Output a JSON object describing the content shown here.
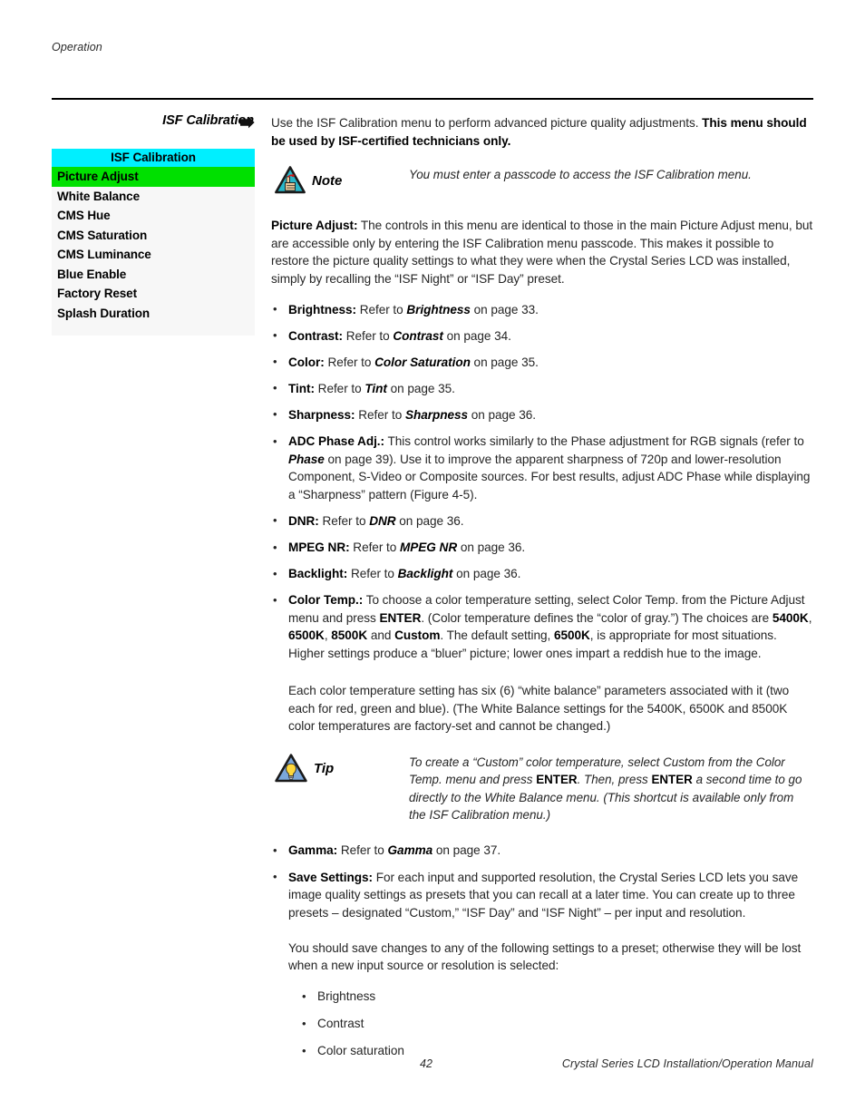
{
  "header": {
    "running_head": "Operation",
    "section_title": "ISF Calibration",
    "arrow_icon": "right-arrow-marker"
  },
  "osd_menu": {
    "title": "ISF Calibration",
    "title_color": "#00EFFF",
    "selected_color": "#00E000",
    "items": [
      {
        "label": "Picture Adjust",
        "selected": true
      },
      {
        "label": "White Balance",
        "selected": false
      },
      {
        "label": "CMS Hue",
        "selected": false
      },
      {
        "label": "CMS Saturation",
        "selected": false
      },
      {
        "label": "CMS Luminance",
        "selected": false
      },
      {
        "label": "Blue Enable",
        "selected": false
      },
      {
        "label": "Factory Reset",
        "selected": false
      },
      {
        "label": "Splash Duration",
        "selected": false
      }
    ]
  },
  "intro": {
    "text_normal": "Use the ISF Calibration menu to perform advanced picture quality adjustments. ",
    "text_bold": "This menu should be used by ISF-certified technicians only."
  },
  "note": {
    "icon": "note-triangle-hand-icon",
    "label": "Note",
    "text": "You must enter a passcode to access the ISF Calibration menu."
  },
  "picture_adjust": {
    "lead_bold": "Picture Adjust:",
    "lead_text": " The controls in this menu are identical to those in the main Picture Adjust menu, but are accessible only by entering the ISF Calibration menu passcode. This makes it possible to restore the picture quality settings to what they were when the Crystal Series LCD was installed, simply by recalling the “ISF Night” or “ISF Day” preset."
  },
  "bullets": [
    {
      "term": "Brightness:",
      "pre": " Refer to ",
      "ref": "Brightness",
      "post": " on page 33."
    },
    {
      "term": "Contrast:",
      "pre": " Refer to ",
      "ref": "Contrast",
      "post": " on page 34."
    },
    {
      "term": "Color:",
      "pre": " Refer to ",
      "ref": "Color Saturation",
      "post": " on page 35."
    },
    {
      "term": "Tint:",
      "pre": " Refer to ",
      "ref": "Tint",
      "post": " on page 35."
    },
    {
      "term": "Sharpness:",
      "pre": " Refer to ",
      "ref": "Sharpness",
      "post": " on page 36."
    }
  ],
  "adc_bullet": {
    "term": "ADC Phase Adj.:",
    "part1": " This control works similarly to the Phase adjustment for RGB signals (refer to ",
    "ref": "Phase",
    "part2": " on page 39). Use it to improve the apparent sharpness of 720p and lower-resolution Component, S-Video or Composite sources. For best results, adjust ADC Phase while displaying a “Sharpness” pattern (Figure 4-5)."
  },
  "bullets2": [
    {
      "term": "DNR:",
      "pre": " Refer to ",
      "ref": "DNR",
      "post": " on page 36."
    },
    {
      "term": "MPEG NR:",
      "pre": " Refer to ",
      "ref": "MPEG NR",
      "post": " on page 36."
    },
    {
      "term": "Backlight:",
      "pre": " Refer to ",
      "ref": "Backlight",
      "post": " on page 36."
    }
  ],
  "color_temp_bullet": {
    "term": "Color Temp.:",
    "p1": " To choose a color temperature setting, select Color Temp. from the Picture Adjust menu and press ",
    "enter": "ENTER",
    "p2": ". (Color temperature defines the “color of gray.”) The choices are ",
    "opt1": "5400K",
    "sep1": ", ",
    "opt2": "6500K",
    "sep2": ", ",
    "opt3": "8500K",
    "sep3": " and ",
    "opt4": "Custom",
    "p3": ". The default setting, ",
    "opt5": "6500K",
    "p4": ", is appropriate for most situations. Higher settings produce a “bluer” picture; lower ones impart a reddish hue to the image."
  },
  "white_balance_para": "Each color temperature setting has six (6) “white balance” parameters associated with it (two each for red, green and blue). (The White Balance settings for the 5400K, 6500K and 8500K color temperatures are factory-set and cannot be changed.)",
  "tip": {
    "icon": "tip-triangle-lightbulb-icon",
    "label": "Tip",
    "p1": "To create a “Custom” color temperature, select Custom from the Color Temp. menu and press ",
    "enter1": "ENTER",
    "p2": ". Then, press ",
    "enter2": "ENTER",
    "p3": " a second time to go directly to the White Balance menu. (This shortcut is available only from the ISF Calibration menu.)"
  },
  "gamma_bullet": {
    "term": "Gamma:",
    "pre": " Refer to ",
    "ref": "Gamma",
    "post": " on page 37."
  },
  "save_settings_bullet": {
    "term": "Save Settings:",
    "text": " For each input and supported resolution, the Crystal Series LCD lets you save image quality settings as presets that you can recall at a later time. You can create up to three presets – designated “Custom,” “ISF Day” and “ISF Night” – per input and resolution."
  },
  "save_note_para": "You should save changes to any of the following settings to a preset; otherwise they will be lost when a new input source or resolution is selected:",
  "save_items": [
    "Brightness",
    "Contrast",
    "Color saturation"
  ],
  "footer": {
    "page_number": "42",
    "manual_title": "Crystal Series LCD Installation/Operation Manual"
  }
}
